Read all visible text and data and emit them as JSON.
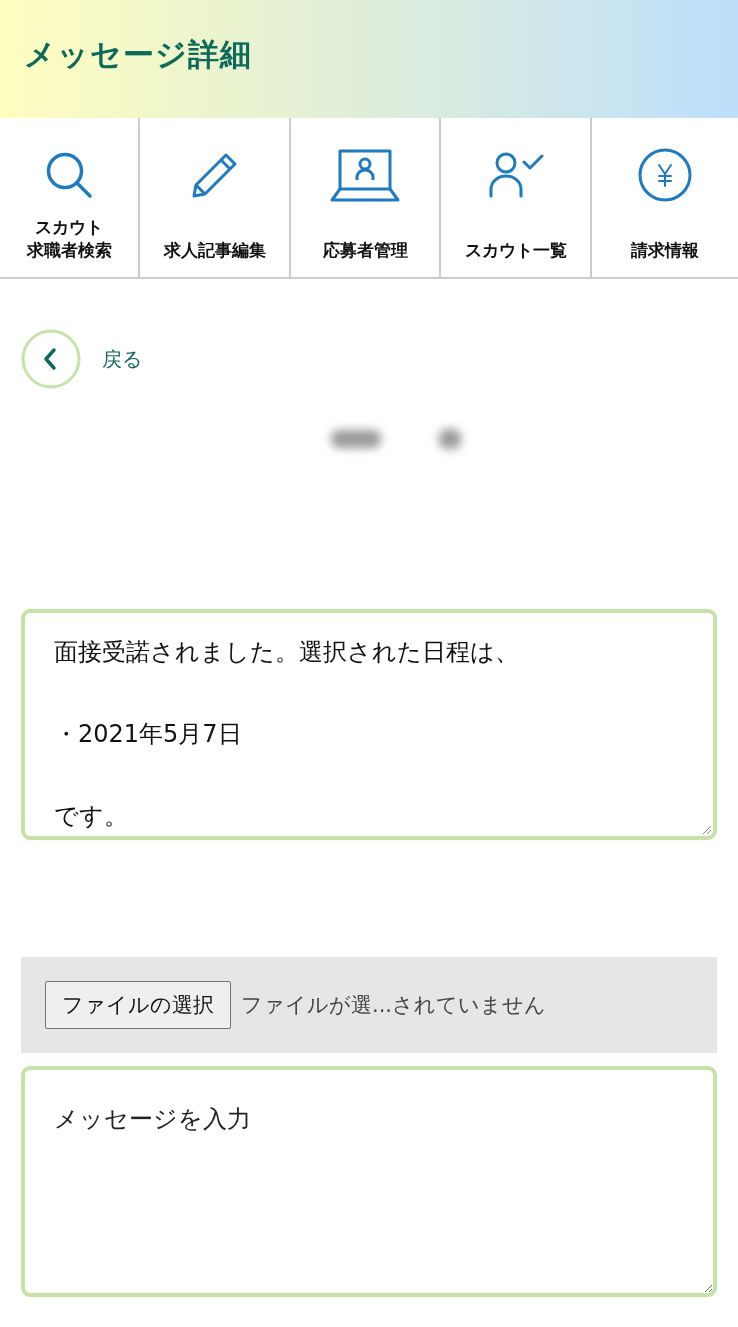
{
  "header": {
    "title": "メッセージ詳細"
  },
  "nav": [
    {
      "kind": "search",
      "lines": [
        "スカウト",
        "求職者検索"
      ]
    },
    {
      "kind": "pencil",
      "lines": [
        "求人記事編集"
      ]
    },
    {
      "kind": "laptop",
      "lines": [
        "応募者管理"
      ]
    },
    {
      "kind": "person-check",
      "lines": [
        "スカウト一覧"
      ]
    },
    {
      "kind": "yen",
      "lines": [
        "請求情報"
      ]
    }
  ],
  "back": {
    "label": "戻る"
  },
  "message": {
    "lines": [
      "面接受諾されました。選択された日程は、",
      "・2021年5月7日",
      "です。"
    ]
  },
  "attachment": {
    "button": "ファイルの選択",
    "status": "ファイルが選...されていません"
  },
  "reply": {
    "placeholder": "メッセージを入力"
  }
}
